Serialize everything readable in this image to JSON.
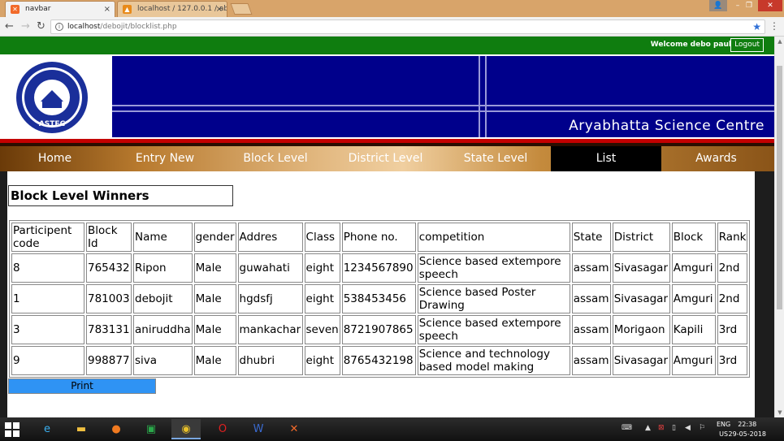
{
  "browser": {
    "tabs": [
      {
        "title": "navbar",
        "close": "×",
        "favicon": "xampp-icon"
      },
      {
        "title": "localhost / 127.0.0.1 / ab",
        "close": "×",
        "favicon": "phpmyadmin-icon"
      }
    ],
    "url_host": "localhost",
    "url_path": "/debojit/blocklist.php"
  },
  "topbar": {
    "welcome": "Welcome debo paul",
    "logout": "Logout"
  },
  "banner": {
    "centre_name": "Aryabhatta Science Centre",
    "logo_text": "ASTEC"
  },
  "menu": [
    {
      "label": "Home"
    },
    {
      "label": "Entry New"
    },
    {
      "label": "Block Level"
    },
    {
      "label": "District Level"
    },
    {
      "label": "State Level"
    },
    {
      "label": "List"
    },
    {
      "label": "Awards"
    }
  ],
  "page": {
    "heading": "Block Level Winners",
    "print": "Print"
  },
  "table": {
    "headers": [
      "Participent code",
      "Block Id",
      "Name",
      "gender",
      "Addres",
      "Class",
      "Phone no.",
      "competition",
      "State",
      "District",
      "Block",
      "Rank"
    ],
    "rows": [
      [
        "8",
        "765432",
        "Ripon",
        "Male",
        "guwahati",
        "eight",
        "1234567890",
        "Science based extempore speech",
        "assam",
        "Sivasagar",
        "Amguri",
        "2nd"
      ],
      [
        "1",
        "781003",
        "debojit",
        "Male",
        "hgdsfj",
        "eight",
        "538453456",
        "Science based Poster Drawing",
        "assam",
        "Sivasagar",
        "Amguri",
        "2nd"
      ],
      [
        "3",
        "783131",
        "aniruddha",
        "Male",
        "mankachar",
        "seven",
        "8721907865",
        "Science based extempore speech",
        "assam",
        "Morigaon",
        "Kapili",
        "3rd"
      ],
      [
        "9",
        "998877",
        "siva",
        "Male",
        "dhubri",
        "eight",
        "8765432198",
        "Science and technology based model making",
        "assam",
        "Sivasagar",
        "Amguri",
        "3rd"
      ]
    ]
  },
  "taskbar": {
    "lang_top": "ENG",
    "lang_bottom": "US",
    "time": "22:38",
    "date": "29-05-2018"
  }
}
